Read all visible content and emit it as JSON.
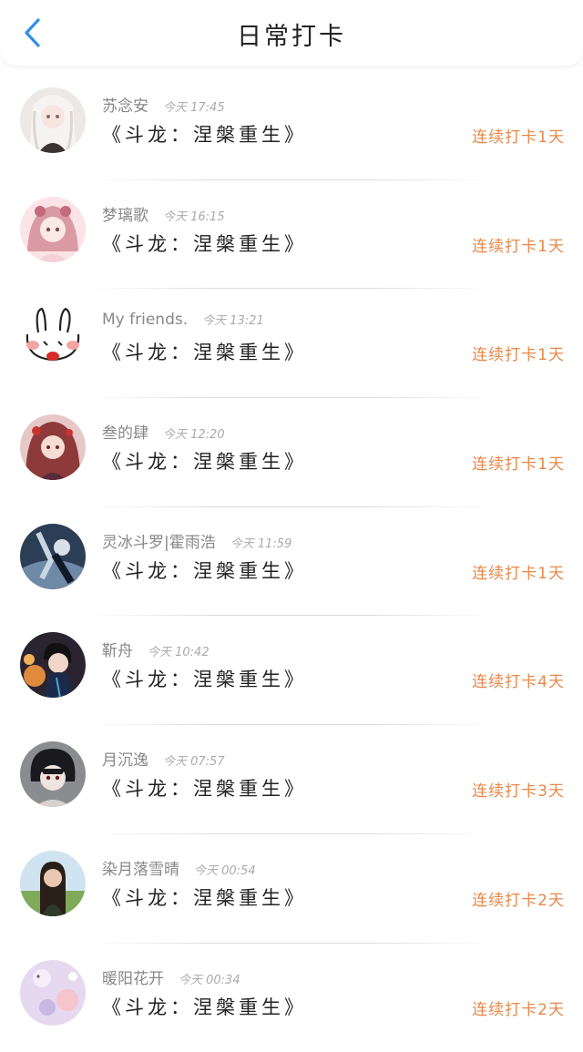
{
  "header": {
    "title": "日常打卡",
    "back_icon": "chevron-left-icon"
  },
  "accent_color": "#2f8fe8",
  "streak_color": "#e8884a",
  "entries": [
    {
      "name": "苏念安",
      "time": "今天 17:45",
      "book": "《斗龙：涅槃重生》",
      "streak": "连续打卡1天",
      "avatar": "anime-girl-white-hair"
    },
    {
      "name": "梦璃歌",
      "time": "今天 16:15",
      "book": "《斗龙：涅槃重生》",
      "streak": "连续打卡1天",
      "avatar": "anime-girl-pink"
    },
    {
      "name": "My friends.",
      "time": "今天 13:21",
      "book": "《斗龙：涅槃重生》",
      "streak": "连续打卡1天",
      "avatar": "doodle-rabbit"
    },
    {
      "name": "叁的肆",
      "time": "今天 12:20",
      "book": "《斗龙：涅槃重生》",
      "streak": "连续打卡1天",
      "avatar": "anime-girl-red"
    },
    {
      "name": "灵冰斗罗|霍雨浩",
      "time": "今天 11:59",
      "book": "《斗龙：涅槃重生》",
      "streak": "连续打卡1天",
      "avatar": "anime-dark-blue"
    },
    {
      "name": "靳舟",
      "time": "今天 10:42",
      "book": "《斗龙：涅槃重生》",
      "streak": "连续打卡4天",
      "avatar": "anime-boy-sunset"
    },
    {
      "name": "月沉逸",
      "time": "今天 07:57",
      "book": "《斗龙：涅槃重生》",
      "streak": "连续打卡3天",
      "avatar": "anime-boy-dark-hair"
    },
    {
      "name": "染月落雪晴",
      "time": "今天 00:54",
      "book": "《斗龙：涅槃重生》",
      "streak": "连续打卡2天",
      "avatar": "photo-girl-outdoor"
    },
    {
      "name": "暖阳花开",
      "time": "今天 00:34",
      "book": "《斗龙：涅槃重生》",
      "streak": "连续打卡2天",
      "avatar": "pastel-bunny"
    }
  ]
}
